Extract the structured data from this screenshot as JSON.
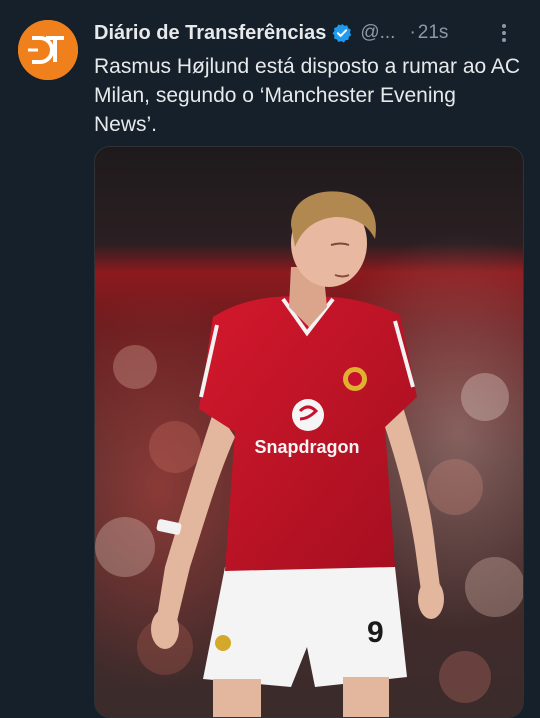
{
  "account": {
    "display_name": "Diário de Transferências",
    "handle": "@...",
    "timestamp": "21s",
    "separator": "·",
    "avatar_initials": "DT",
    "verified": true
  },
  "tweet": {
    "text": "Rasmus Højlund está disposto a rumar ao AC Milan, segundo o ‘Manchester Evening News’."
  },
  "media": {
    "shirt_sponsor": "Snapdragon",
    "shirt_number": "9"
  },
  "colors": {
    "background": "#15202b",
    "avatar_bg": "#f0801c",
    "verified_badge": "#1d9bf0",
    "muted_text": "#8b98a5",
    "jersey_red": "#c8102e"
  },
  "icons": {
    "verified": "verified-badge-icon",
    "more": "more-options-icon"
  }
}
